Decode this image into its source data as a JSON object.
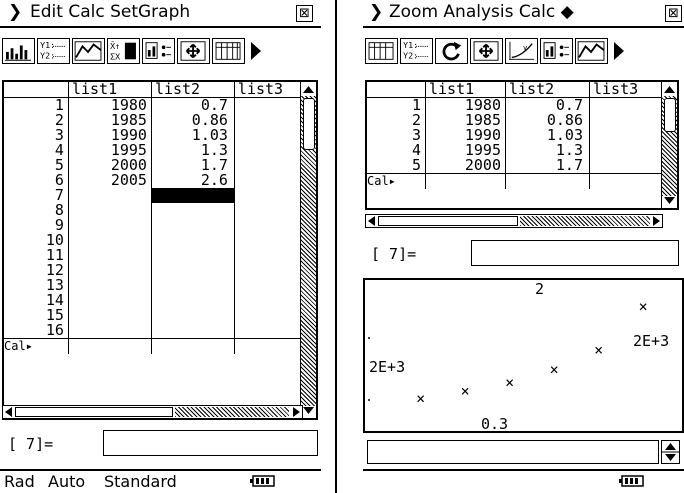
{
  "left": {
    "menu": {
      "title": "Edit Calc SetGraph",
      "close": "⊠"
    },
    "headers": [
      "",
      "list1",
      "list2",
      "list3"
    ],
    "rows": [
      [
        "1",
        "1980",
        "0.7",
        ""
      ],
      [
        "2",
        "1985",
        "0.86",
        ""
      ],
      [
        "3",
        "1990",
        "1.03",
        ""
      ],
      [
        "4",
        "1995",
        "1.3",
        ""
      ],
      [
        "5",
        "2000",
        "1.7",
        ""
      ],
      [
        "6",
        "2005",
        "2.6",
        ""
      ],
      [
        "7",
        "",
        "",
        ""
      ],
      [
        "8",
        "",
        "",
        ""
      ],
      [
        "9",
        "",
        "",
        ""
      ],
      [
        "10",
        "",
        "",
        ""
      ],
      [
        "11",
        "",
        "",
        ""
      ],
      [
        "12",
        "",
        "",
        ""
      ],
      [
        "13",
        "",
        "",
        ""
      ],
      [
        "14",
        "",
        "",
        ""
      ],
      [
        "15",
        "",
        "",
        ""
      ],
      [
        "16",
        "",
        "",
        ""
      ]
    ],
    "cal_label": "Cal▸",
    "input_prefix": "[   7]=",
    "status": {
      "mode1": "Rad",
      "mode2": "Auto",
      "mode3": "Standard"
    }
  },
  "right": {
    "menu": {
      "title": "Zoom Analysis Calc ◆",
      "close": "⊠"
    },
    "headers": [
      "",
      "list1",
      "list2",
      "list3"
    ],
    "rows": [
      [
        "1",
        "1980",
        "0.7",
        ""
      ],
      [
        "2",
        "1985",
        "0.86",
        ""
      ],
      [
        "3",
        "1990",
        "1.03",
        ""
      ],
      [
        "4",
        "1995",
        "1.3",
        ""
      ],
      [
        "5",
        "2000",
        "1.7",
        ""
      ]
    ],
    "cal_label": "Cal▸",
    "input_prefix": "[   7]=",
    "graph": {
      "label_top": "2",
      "label_right": "2E+3",
      "label_left": "2E+3",
      "label_bottom": "0.3"
    }
  },
  "chart_data": {
    "type": "scatter",
    "title": "",
    "x": [
      1980,
      1985,
      1990,
      1995,
      2000,
      2005
    ],
    "y": [
      0.7,
      0.86,
      1.03,
      1.3,
      1.7,
      2.6
    ],
    "xlim": [
      1976,
      2007
    ],
    "ylim": [
      0.3,
      2.9
    ],
    "marker": "×",
    "grid": false
  }
}
